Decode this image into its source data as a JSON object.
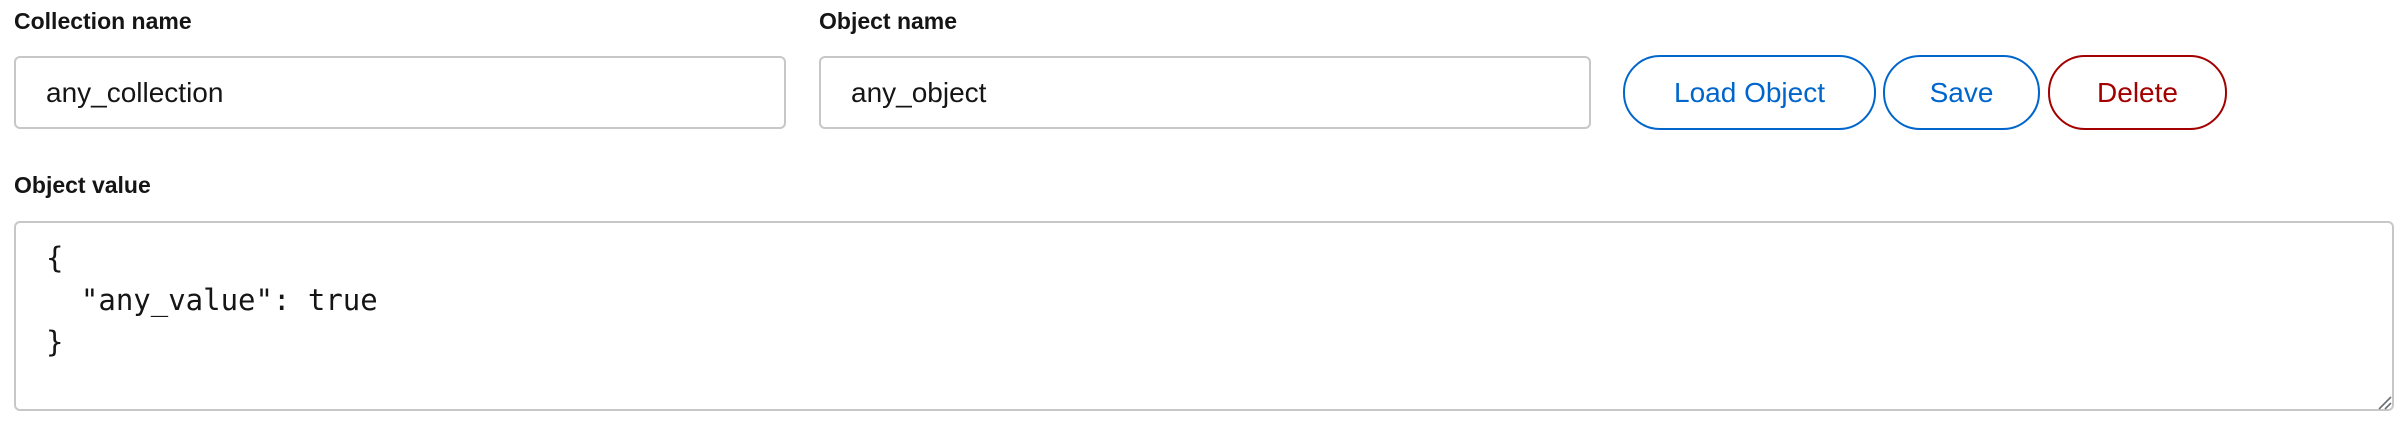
{
  "collection": {
    "label": "Collection name",
    "value": "any_collection"
  },
  "object": {
    "label": "Object name",
    "value": "any_object"
  },
  "actions": {
    "load_label": "Load Object",
    "save_label": "Save",
    "delete_label": "Delete"
  },
  "object_value": {
    "label": "Object value",
    "value": "{\n  \"any_value\": true\n}"
  },
  "colors": {
    "primary": "#0066cc",
    "danger": "#a30000",
    "border": "#c7c7c7",
    "text": "#151515"
  },
  "icons": {
    "resize": "resize-handle-icon"
  }
}
